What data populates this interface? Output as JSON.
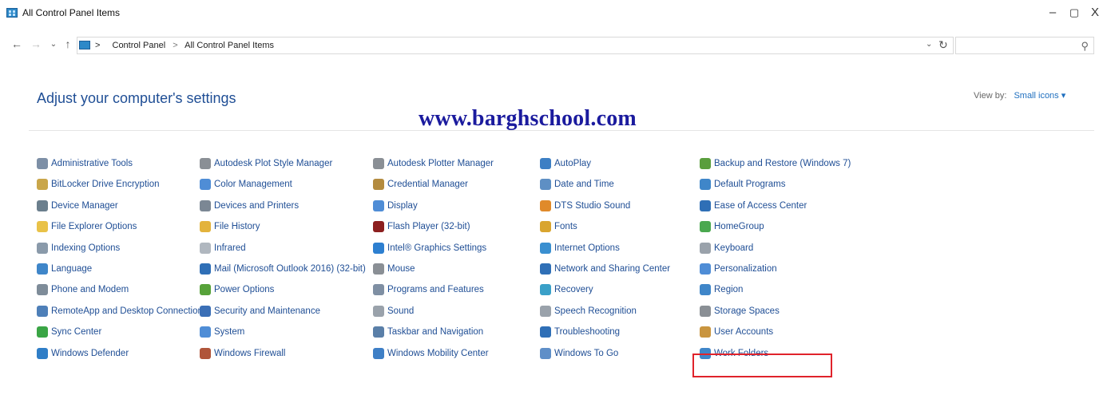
{
  "window": {
    "title": "All Control Panel Items",
    "minimize": "–",
    "maximize": "▢",
    "close": "X"
  },
  "nav": {
    "back": "←",
    "forward": "→",
    "recent": "⌄",
    "up": "↑",
    "refresh": "↻",
    "dropdown": "⌄",
    "search_icon": "⚲",
    "breadcrumb": [
      "Control Panel",
      "All Control Panel Items"
    ],
    "separator": ">"
  },
  "header": {
    "title": "Adjust your computer's settings",
    "view_by_label": "View by:",
    "view_by_value": "Small icons ▾",
    "watermark": "www.barghschool.com"
  },
  "columns": [
    [
      {
        "label": "Administrative Tools",
        "icon": "tools-icon",
        "color": "#7d8fa6"
      },
      {
        "label": "BitLocker Drive Encryption",
        "icon": "key-icon",
        "color": "#c9a64a"
      },
      {
        "label": "Device Manager",
        "icon": "device-manager-icon",
        "color": "#6b7f8d"
      },
      {
        "label": "File Explorer Options",
        "icon": "folder-options-icon",
        "color": "#e9c248"
      },
      {
        "label": "Indexing Options",
        "icon": "indexing-icon",
        "color": "#8a9aaa"
      },
      {
        "label": "Language",
        "icon": "language-icon",
        "color": "#3f86c9"
      },
      {
        "label": "Phone and Modem",
        "icon": "phone-icon",
        "color": "#7e8c99"
      },
      {
        "label": "RemoteApp and Desktop Connections",
        "icon": "remote-icon",
        "color": "#4e7fb8"
      },
      {
        "label": "Sync Center",
        "icon": "sync-icon",
        "color": "#3aa545"
      },
      {
        "label": "Windows Defender",
        "icon": "defender-icon",
        "color": "#2f7ec7"
      }
    ],
    [
      {
        "label": "Autodesk Plot Style Manager",
        "icon": "plot-style-icon",
        "color": "#8a8f95"
      },
      {
        "label": "Color Management",
        "icon": "color-icon",
        "color": "#4f8dd6"
      },
      {
        "label": "Devices and Printers",
        "icon": "printer-icon",
        "color": "#7b8794"
      },
      {
        "label": "File History",
        "icon": "file-history-icon",
        "color": "#e3b33c"
      },
      {
        "label": "Infrared",
        "icon": "infrared-icon",
        "color": "#b0b7bf"
      },
      {
        "label": "Mail (Microsoft Outlook 2016) (32-bit)",
        "icon": "mail-icon",
        "color": "#2f6fb6"
      },
      {
        "label": "Power Options",
        "icon": "power-icon",
        "color": "#57a23a"
      },
      {
        "label": "Security and Maintenance",
        "icon": "flag-icon",
        "color": "#3b6fb6"
      },
      {
        "label": "System",
        "icon": "system-icon",
        "color": "#4f8dd6"
      },
      {
        "label": "Windows Firewall",
        "icon": "firewall-icon",
        "color": "#b0553a"
      }
    ],
    [
      {
        "label": "Autodesk Plotter Manager",
        "icon": "plotter-icon",
        "color": "#8a8f95"
      },
      {
        "label": "Credential Manager",
        "icon": "credential-icon",
        "color": "#b38b3f"
      },
      {
        "label": "Display",
        "icon": "display-icon",
        "color": "#4f8dd6"
      },
      {
        "label": "Flash Player (32-bit)",
        "icon": "flash-icon",
        "color": "#8c1f1f"
      },
      {
        "label": "Intel® Graphics Settings",
        "icon": "intel-icon",
        "color": "#2d7fd0"
      },
      {
        "label": "Mouse",
        "icon": "mouse-icon",
        "color": "#8a8f95"
      },
      {
        "label": "Programs and Features",
        "icon": "programs-icon",
        "color": "#7f8fa3"
      },
      {
        "label": "Sound",
        "icon": "sound-icon",
        "color": "#9aa2ab"
      },
      {
        "label": "Taskbar and Navigation",
        "icon": "taskbar-icon",
        "color": "#5a7fa8"
      },
      {
        "label": "Windows Mobility Center",
        "icon": "mobility-icon",
        "color": "#3e7fc6"
      }
    ],
    [
      {
        "label": "AutoPlay",
        "icon": "autoplay-icon",
        "color": "#3d7fc4"
      },
      {
        "label": "Date and Time",
        "icon": "clock-icon",
        "color": "#5e8fc4"
      },
      {
        "label": "DTS Studio Sound",
        "icon": "dts-icon",
        "color": "#e08a2a"
      },
      {
        "label": "Fonts",
        "icon": "fonts-icon",
        "color": "#d9a52f"
      },
      {
        "label": "Internet Options",
        "icon": "internet-icon",
        "color": "#3a8fd0"
      },
      {
        "label": "Network and Sharing Center",
        "icon": "network-icon",
        "color": "#2f6fb6"
      },
      {
        "label": "Recovery",
        "icon": "recovery-icon",
        "color": "#3aa0c8"
      },
      {
        "label": "Speech Recognition",
        "icon": "microphone-icon",
        "color": "#9aa2ab"
      },
      {
        "label": "Troubleshooting",
        "icon": "troubleshoot-icon",
        "color": "#2f6fb6"
      },
      {
        "label": "Windows To Go",
        "icon": "windows-to-go-icon",
        "color": "#5f8fc8"
      }
    ],
    [
      {
        "label": "Backup and Restore (Windows 7)",
        "icon": "backup-icon",
        "color": "#5a9e3d"
      },
      {
        "label": "Default Programs",
        "icon": "default-programs-icon",
        "color": "#3f86c9"
      },
      {
        "label": "Ease of Access Center",
        "icon": "ease-of-access-icon",
        "color": "#2f6fb6"
      },
      {
        "label": "HomeGroup",
        "icon": "homegroup-icon",
        "color": "#4aa84f"
      },
      {
        "label": "Keyboard",
        "icon": "keyboard-icon",
        "color": "#9aa2ab"
      },
      {
        "label": "Personalization",
        "icon": "personalization-icon",
        "color": "#4f8dd6"
      },
      {
        "label": "Region",
        "icon": "region-icon",
        "color": "#3f86c9"
      },
      {
        "label": "Storage Spaces",
        "icon": "storage-icon",
        "color": "#8a8f95"
      },
      {
        "label": "User Accounts",
        "icon": "user-accounts-icon",
        "color": "#c9953f"
      },
      {
        "label": "Work Folders",
        "icon": "work-folders-icon",
        "color": "#3f86c9"
      }
    ]
  ],
  "highlight": {
    "target": "User Accounts",
    "color": "#e0232b"
  }
}
